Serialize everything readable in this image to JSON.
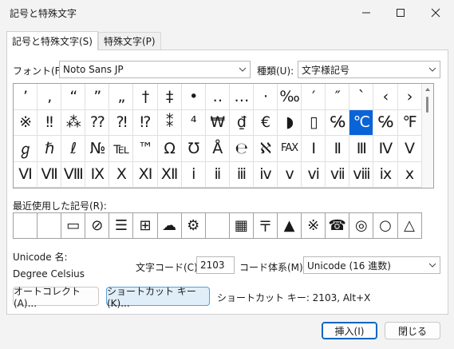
{
  "window": {
    "title": "記号と特殊文字"
  },
  "tabs": [
    {
      "label": "記号と特殊文字(S)"
    },
    {
      "label": "特殊文字(P)"
    }
  ],
  "font": {
    "label": "フォント(F):",
    "value": "Noto Sans JP"
  },
  "subset": {
    "label": "種類(U):",
    "value": "文字様記号"
  },
  "symbols": {
    "rows": [
      [
        "’",
        "‚",
        "“",
        "”",
        "„",
        "†",
        "‡",
        "•",
        "‥",
        "…",
        "·",
        "‰",
        "′",
        "″",
        "`",
        "‹",
        "›"
      ],
      [
        "※",
        "‼",
        "⁂",
        "⁇",
        "⁈",
        "⁉",
        "⁑",
        "⁴",
        "₩",
        "₫",
        "€",
        "◗",
        "▯",
        "℅",
        "℃",
        "℅",
        "℉"
      ],
      [
        "ℊ",
        "ℏ",
        "ℓ",
        "№",
        "℡",
        "™",
        "Ω",
        "℧",
        "Å",
        "℮",
        "ℵ",
        "FAX",
        "Ⅰ",
        "Ⅱ",
        "Ⅲ",
        "Ⅳ",
        "Ⅴ"
      ],
      [
        "Ⅵ",
        "Ⅶ",
        "Ⅷ",
        "Ⅸ",
        "Ⅹ",
        "Ⅺ",
        "Ⅻ",
        "ⅰ",
        "ⅱ",
        "ⅲ",
        "ⅳ",
        "ⅴ",
        "ⅵ",
        "ⅶ",
        "ⅷ",
        "ⅸ",
        "ⅹ"
      ]
    ],
    "selected": "℃"
  },
  "recent": {
    "label": "最近使用した記号(R):",
    "items": [
      "",
      "",
      "▭",
      "⊘",
      "☰",
      "⊞",
      "☁",
      "⚙",
      "",
      "▦",
      "〒",
      "▲",
      "※",
      "☎",
      "◎",
      "○",
      "△"
    ]
  },
  "unicode_name": {
    "label": "Unicode 名:",
    "value": "Degree Celsius"
  },
  "char_code": {
    "label": "文字コード(C):",
    "value": "2103"
  },
  "from": {
    "label": "コード体系(M):",
    "value": "Unicode (16 進数)"
  },
  "buttons": {
    "autocorrect": "オートコレクト(A)...",
    "shortcut_key": "ショートカット キー(K)...",
    "insert": "挿入(I)",
    "close": "閉じる"
  },
  "shortcut_text": "ショートカット キー: 2103, Alt+X",
  "colors": {
    "accent": "#0a64d8",
    "background": "#f3f3f3"
  }
}
